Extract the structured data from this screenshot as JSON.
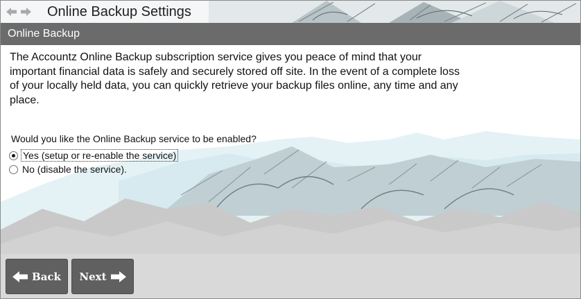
{
  "window": {
    "title": "Online Backup Settings"
  },
  "nav": {
    "back_icon": "arrow-left-icon",
    "forward_icon": "arrow-right-icon"
  },
  "section": {
    "header": "Online Backup"
  },
  "content": {
    "intro": "The Accountz Online Backup subscription service gives you peace of mind that your important financial data is safely and securely stored off site. In the event of a complete loss of your locally held data, you can quickly retrieve your backup files online, any time and any place.",
    "question": "Would you like the Online Backup service to be enabled?",
    "options": [
      {
        "label": "Yes (setup or re-enable the service)",
        "selected": true
      },
      {
        "label": "No (disable the service).",
        "selected": false
      }
    ]
  },
  "buttons": {
    "back_label": "Back",
    "next_label": "Next"
  },
  "colors": {
    "header_bg": "#6b6b6b",
    "button_bg": "#606060",
    "mountain_light": "#d9eef3",
    "mountain_grey": "#c4c4c4"
  }
}
